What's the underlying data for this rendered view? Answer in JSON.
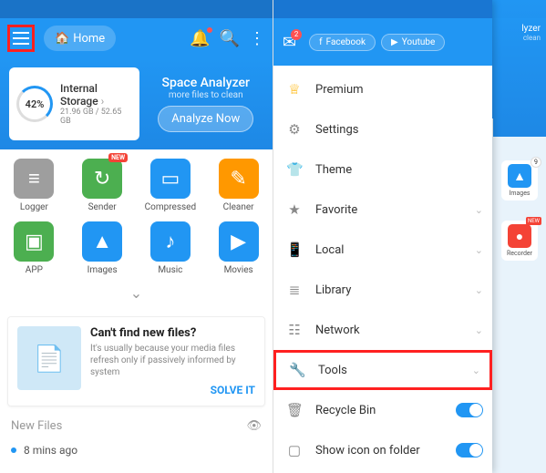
{
  "left": {
    "topbar": {
      "home": "Home"
    },
    "analyzer": {
      "title": "Space Analyzer",
      "sub": "more files to clean",
      "btn": "Analyze Now"
    },
    "storage": {
      "pct": "42%",
      "title": "Internal Storage",
      "sub": "21.96 GB / 52.65 GB"
    },
    "grid": [
      {
        "label": "Logger",
        "color": "#9e9e9e",
        "glyph": "≡",
        "new": false
      },
      {
        "label": "Sender",
        "color": "#4caf50",
        "glyph": "↻",
        "new": true
      },
      {
        "label": "Compressed",
        "color": "#2196f3",
        "glyph": "▭",
        "new": false
      },
      {
        "label": "Cleaner",
        "color": "#ff9800",
        "glyph": "✎",
        "new": false
      },
      {
        "label": "APP",
        "color": "#4caf50",
        "glyph": "▣",
        "new": false
      },
      {
        "label": "Images",
        "color": "#2196f3",
        "glyph": "▲",
        "new": false
      },
      {
        "label": "Music",
        "color": "#2196f3",
        "glyph": "♪",
        "new": false
      },
      {
        "label": "Movies",
        "color": "#2196f3",
        "glyph": "▶",
        "new": false
      }
    ],
    "new_badge": "NEW",
    "card": {
      "title": "Can't find new files?",
      "desc": "It's usually because your media files refresh only if passively informed by system",
      "action": "SOLVE IT"
    },
    "newfiles": {
      "header": "New Files",
      "item": "8 mins ago"
    }
  },
  "right": {
    "mail_count": "2",
    "social": [
      {
        "label": "Facebook",
        "glyph": "f"
      },
      {
        "label": "Youtube",
        "glyph": "▶"
      }
    ],
    "menu": [
      {
        "label": "Premium",
        "icon": "♕",
        "icolor": "#ffb300"
      },
      {
        "label": "Settings",
        "icon": "⚙"
      },
      {
        "label": "Theme",
        "icon": "👕"
      },
      {
        "label": "Favorite",
        "icon": "★",
        "chev": true
      },
      {
        "label": "Local",
        "icon": "📱",
        "chev": true
      },
      {
        "label": "Library",
        "icon": "≣",
        "chev": true
      },
      {
        "label": "Network",
        "icon": "☷",
        "chev": true
      },
      {
        "label": "Tools",
        "icon": "🔧",
        "chev": true,
        "highlight": true
      },
      {
        "label": "Recycle Bin",
        "icon": "🗑",
        "toggle": true
      },
      {
        "label": "Show icon on folder",
        "icon": "▢",
        "toggle": true
      }
    ],
    "peek": {
      "top_text": "lyzer",
      "top_sub": "clean",
      "images": {
        "label": "Images",
        "count": "9"
      },
      "recorder": {
        "label": "Recorder"
      }
    }
  }
}
